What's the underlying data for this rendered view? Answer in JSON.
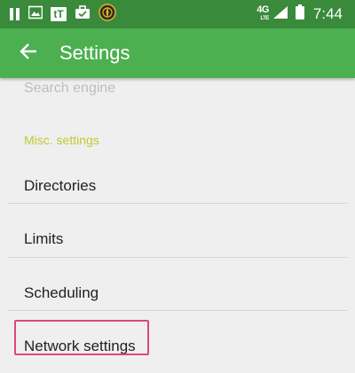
{
  "status_bar": {
    "network_type": "4G",
    "network_sub": "LTE",
    "time": "7:44",
    "left_icons": [
      "pause-icon",
      "image-icon",
      "tt-app-icon",
      "briefcase-check-icon",
      "compass-icon"
    ],
    "right_icons": [
      "lte-data-icon",
      "signal-icon",
      "battery-icon"
    ],
    "tt_glyph": "tT"
  },
  "app_bar": {
    "title": "Settings",
    "back_icon": "arrow-back-icon"
  },
  "settings": {
    "faded_item": "Search engine",
    "category": "Misc. settings",
    "items": [
      {
        "label": "Directories"
      },
      {
        "label": "Limits"
      },
      {
        "label": "Scheduling"
      },
      {
        "label": "Network settings"
      }
    ]
  },
  "colors": {
    "status_bar": "#3a8a3c",
    "app_bar": "#4caf50",
    "category_text": "#c0ca33",
    "highlight": "#e0457b",
    "background": "#efefef"
  }
}
